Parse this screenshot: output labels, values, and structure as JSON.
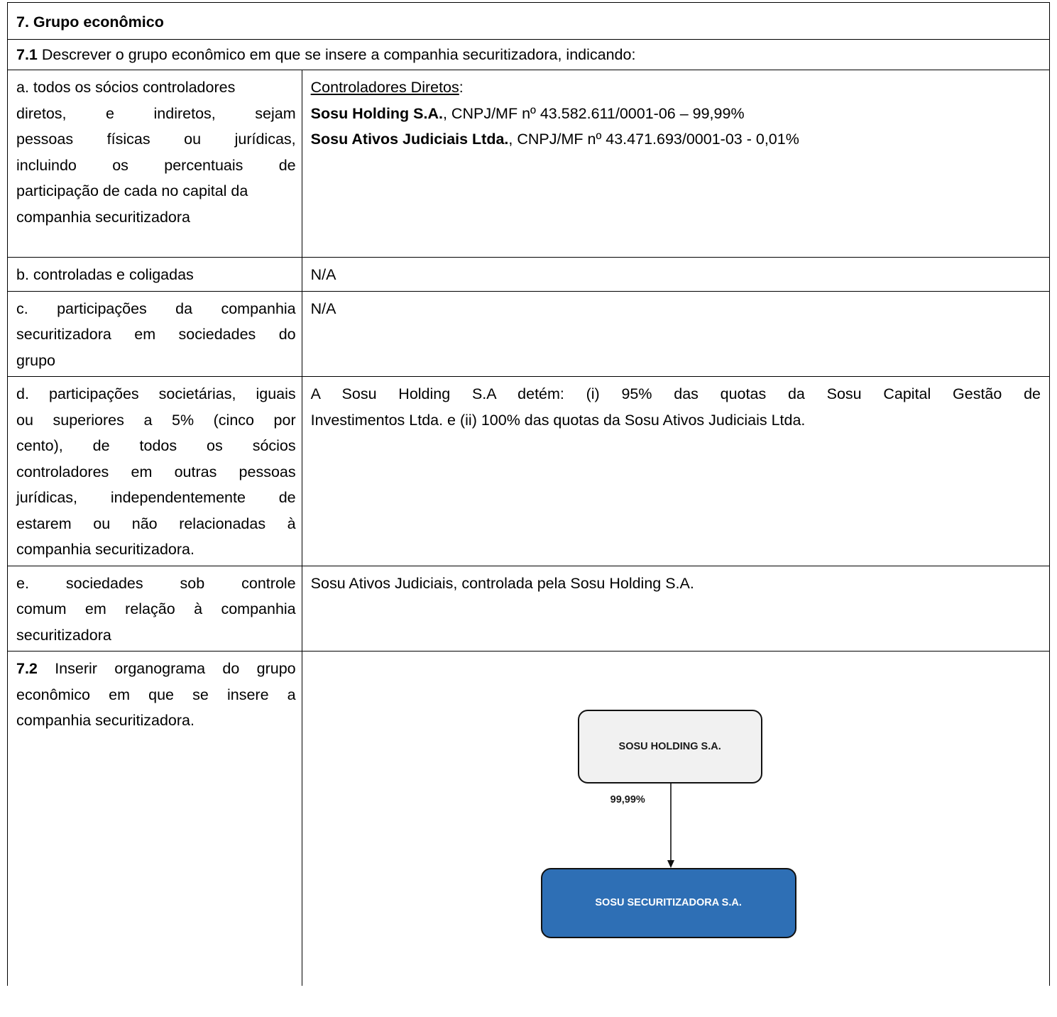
{
  "section": {
    "title": "7. Grupo econômico"
  },
  "q71": {
    "num": "7.1",
    "text": " Descrever o grupo econômico em que se insere a companhia securitizadora, indicando:"
  },
  "rows": {
    "a": {
      "label_lines": [
        "a. todos os sócios controladores",
        "diretos, e indiretos, sejam",
        "pessoas físicas ou jurídicas,",
        "incluindo os percentuais de",
        "participação de cada no capital da",
        "companhia securitizadora"
      ],
      "heading": "Controladores Diretos",
      "heading_suffix": ":",
      "holders": [
        {
          "name": "Sosu Holding S.A.",
          "detail": ", CNPJ/MF nº 43.582.611/0001-06 – 99,99%"
        },
        {
          "name": "Sosu Ativos Judiciais Ltda.",
          "detail": ", CNPJ/MF nº 43.471.693/0001-03 - 0,01%"
        }
      ]
    },
    "b": {
      "label": "b. controladas e coligadas",
      "value": "N/A"
    },
    "c": {
      "label_lines": [
        "c. participações da companhia",
        "securitizadora em sociedades do",
        "grupo"
      ],
      "value": "N/A"
    },
    "d": {
      "label_lines": [
        "d. participações societárias, iguais",
        "ou superiores a 5% (cinco por",
        "cento), de todos os sócios",
        "controladores em outras pessoas",
        "jurídicas, independentemente de",
        "estarem ou não relacionadas à",
        "companhia securitizadora."
      ],
      "value_lines": [
        "A Sosu Holding S.A detém: (i) 95% das quotas da Sosu Capital Gestão de",
        "Investimentos Ltda. e (ii) 100% das quotas da Sosu Ativos Judiciais Ltda."
      ]
    },
    "e": {
      "label_lines": [
        "e. sociedades sob controle",
        "comum em relação à companhia",
        "securitizadora"
      ],
      "value": "Sosu Ativos Judiciais, controlada pela Sosu Holding S.A."
    }
  },
  "q72": {
    "num": "7.2",
    "label_lines": [
      " Inserir organograma do grupo",
      "econômico em que se insere a",
      "companhia securitizadora."
    ],
    "org": {
      "top": "SOSU HOLDING S.A.",
      "percent": "99,99%",
      "bottom": "SOSU SECURITIZADORA S.A.",
      "top_fill": "#f1f1f1",
      "bottom_fill": "#2e6fb5"
    }
  }
}
